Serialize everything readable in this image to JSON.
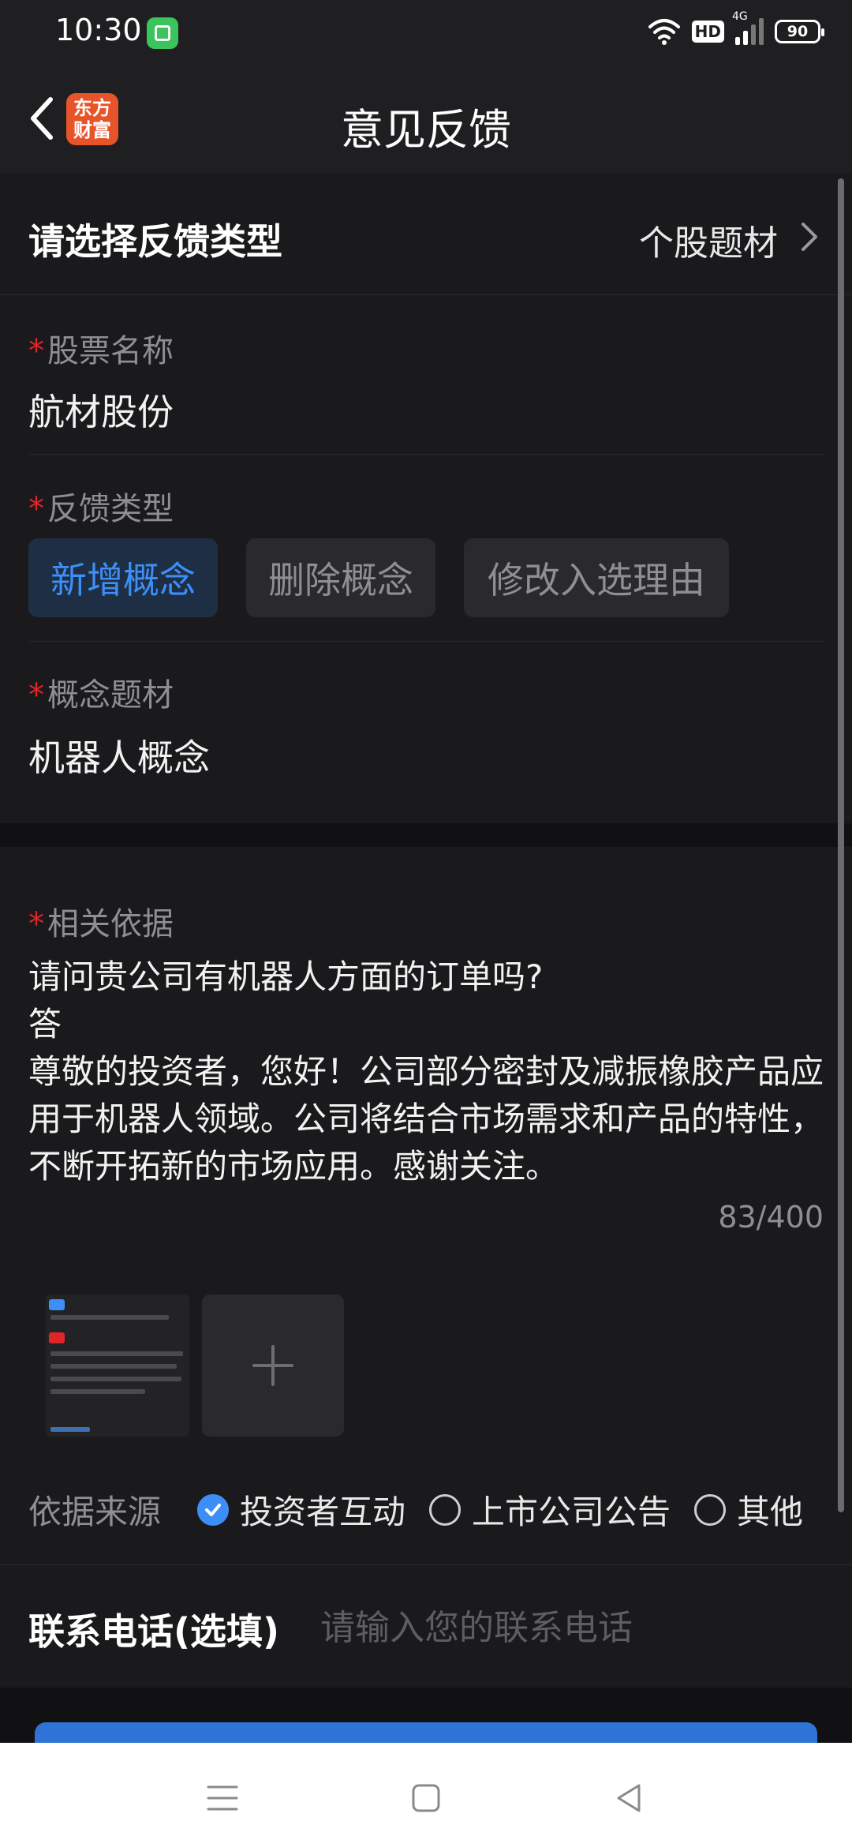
{
  "status_bar": {
    "time": "10:30",
    "hd_label": "HD",
    "network_label": "4G",
    "battery": "90"
  },
  "header": {
    "back_icon": "chevron-left-icon",
    "logo_line1": "东方",
    "logo_line2": "财富",
    "title": "意见反馈"
  },
  "feedback_type_row": {
    "label": "请选择反馈类型",
    "value": "个股题材"
  },
  "stock_name": {
    "required": "*",
    "label": "股票名称",
    "value": "航材股份"
  },
  "feedback_kind": {
    "required": "*",
    "label": "反馈类型",
    "options": [
      "新增概念",
      "删除概念",
      "修改入选理由"
    ],
    "selected": "新增概念"
  },
  "concept": {
    "required": "*",
    "label": "概念题材",
    "value": "机器人概念"
  },
  "basis": {
    "required": "*",
    "label": "相关依据",
    "text": "请问贵公司有机器人方面的订单吗?\n答\n尊敬的投资者，您好！公司部分密封及减振橡胶产品应用于机器人领域。公司将结合市场需求和产品的特性，不断开拓新的市场应用。感谢关注。",
    "counter": "83/400"
  },
  "source": {
    "label": "依据来源",
    "options": [
      "投资者互动",
      "上市公司公告",
      "其他"
    ],
    "selected": "投资者互动"
  },
  "contact": {
    "label": "联系电话(选填)",
    "placeholder": "请输入您的联系电话",
    "value": ""
  },
  "colors": {
    "accent": "#3e8ef7",
    "required": "#e0242a",
    "background": "#1a1a1c",
    "logo": "#e8542a"
  }
}
